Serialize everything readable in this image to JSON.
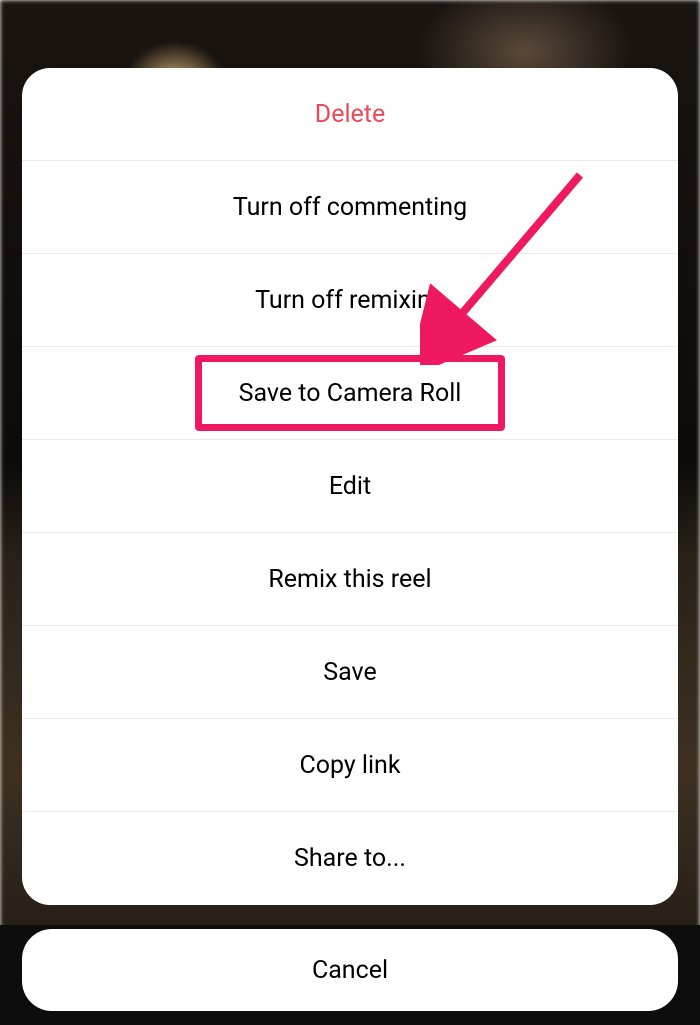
{
  "actions": {
    "delete": "Delete",
    "turn_off_commenting": "Turn off commenting",
    "turn_off_remixing": "Turn off remixing",
    "save_to_camera_roll": "Save to Camera Roll",
    "edit": "Edit",
    "remix_this_reel": "Remix this reel",
    "save": "Save",
    "copy_link": "Copy link",
    "share_to": "Share to..."
  },
  "cancel": "Cancel",
  "annotation": {
    "highlighted_item": "save_to_camera_roll",
    "highlight_color": "#ee1960"
  }
}
